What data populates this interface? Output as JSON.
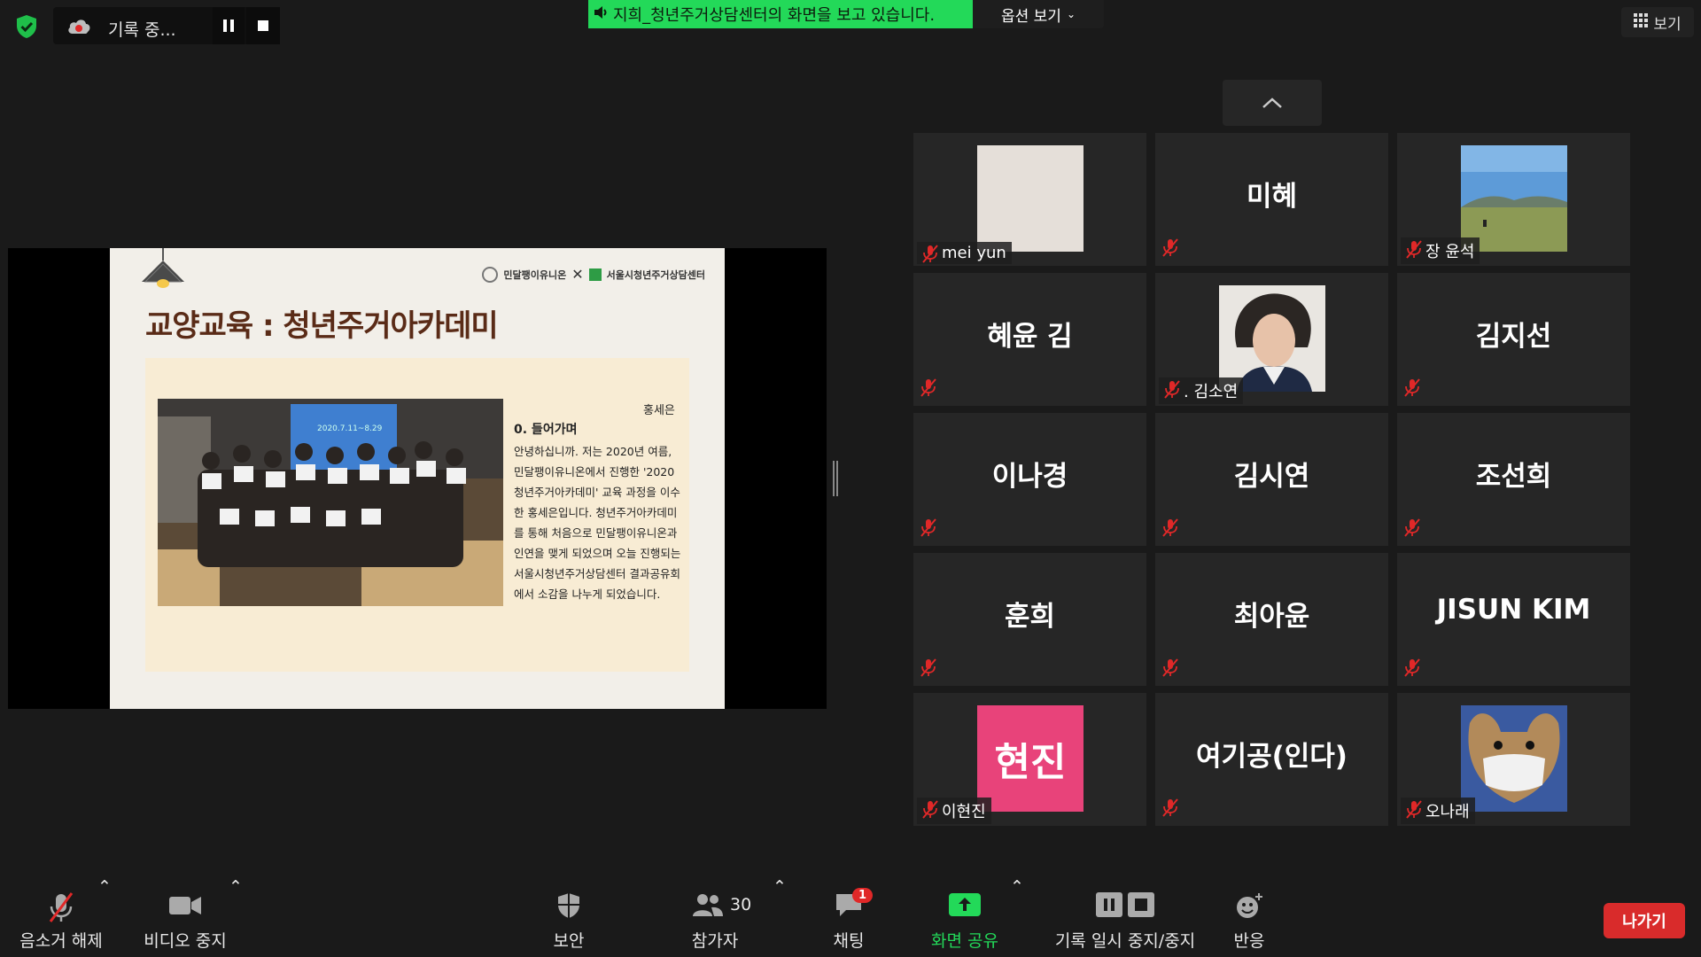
{
  "recording": {
    "label": "기록 중..."
  },
  "share": {
    "banner": "지희_청년주거상담센터의 화면을 보고 있습니다.",
    "options": "옵션 보기"
  },
  "view_button": "보기",
  "slide": {
    "logo_left": "민달팽이유니온",
    "logo_right": "서울시청년주거상담센터",
    "title": "교양교육 : 청년주거아카데미",
    "author": "홍세은",
    "heading": "0. 들어가며",
    "body": "안녕하십니까. 저는 2020년 여름, 민달팽이유니온에서 진행한 '2020 청년주거아카데미' 교육 과정을 이수한 홍세은입니다. 청년주거아카데미를 통해 처음으로 민달팽이유니온과 인연을 맺게 되었으며 오늘 진행되는 서울시청년주거상담센터 결과공유회에서 소감을 나누게 되었습니다.",
    "photo_caption": "2020.7.11~8.29"
  },
  "participants": [
    {
      "name": "mei yun",
      "display": "",
      "type": "photo-blank"
    },
    {
      "name": "",
      "display": "미혜",
      "type": "text"
    },
    {
      "name": "장 윤석",
      "display": "",
      "type": "photo-landscape"
    },
    {
      "name": "",
      "display": "혜윤 김",
      "type": "text"
    },
    {
      "name": ". 김소연",
      "display": "",
      "type": "photo-portrait"
    },
    {
      "name": "",
      "display": "김지선",
      "type": "text"
    },
    {
      "name": "",
      "display": "이나경",
      "type": "text"
    },
    {
      "name": "",
      "display": "김시연",
      "type": "text"
    },
    {
      "name": "",
      "display": "조선희",
      "type": "text"
    },
    {
      "name": "",
      "display": "훈희",
      "type": "text"
    },
    {
      "name": "",
      "display": "최아윤",
      "type": "text"
    },
    {
      "name": "",
      "display": "JISUN KIM",
      "type": "text"
    },
    {
      "name": "이현진",
      "display": "현진",
      "type": "avatar-pink"
    },
    {
      "name": "",
      "display": "여기공(인다)",
      "type": "text"
    },
    {
      "name": "오나래",
      "display": "",
      "type": "photo-dog"
    }
  ],
  "toolbar": {
    "unmute": "음소거 해제",
    "stop_video": "비디오 중지",
    "security": "보안",
    "participants": "참가자",
    "participants_count": "30",
    "chat": "채팅",
    "chat_badge": "1",
    "share_screen": "화면 공유",
    "pause_stop_recording": "기록 일시 중지/중지",
    "reactions": "반응",
    "leave": "나가기"
  },
  "colors": {
    "share_green": "#23d959",
    "leave_red": "#d92b2b",
    "mute_red": "#e02828",
    "pink_avatar": "#e8437a"
  }
}
